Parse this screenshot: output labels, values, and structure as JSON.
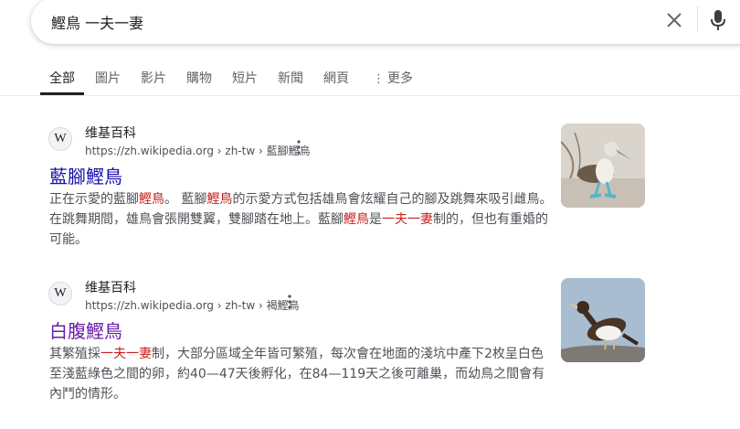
{
  "search": {
    "query": "鰹鳥 一夫一妻"
  },
  "tabs": [
    {
      "label": "全部"
    },
    {
      "label": "圖片"
    },
    {
      "label": "影片"
    },
    {
      "label": "購物"
    },
    {
      "label": "短片"
    },
    {
      "label": "新聞"
    },
    {
      "label": "網頁"
    },
    {
      "label": "更多"
    }
  ],
  "results": [
    {
      "favicon": "W",
      "site": "维基百科",
      "url": "https://zh.wikipedia.org › zh-tw › 藍腳鰹鳥",
      "title": "藍腳鰹鳥",
      "title_color": "#1a0dab",
      "s": [
        "正在示愛的藍腳",
        "鰹鳥",
        "。 藍腳",
        "鰹鳥",
        "的示愛方式包括雄鳥會炫耀自己的腳及跳舞來吸引雌鳥。在跳舞期間，雄鳥會張開雙翼，雙腳踏在地上。藍腳",
        "鰹鳥",
        "是",
        "一夫一妻",
        "制的，但也有重婚的可能。"
      ]
    },
    {
      "favicon": "W",
      "site": "维基百科",
      "url": "https://zh.wikipedia.org › zh-tw › 褐鰹鳥",
      "title": "白腹鰹鳥",
      "title_color": "#681da8",
      "s": [
        "其繁殖採",
        "一夫一妻",
        "制，大部分區域全年皆可繁殖，每次會在地面的淺坑中產下2枚呈白色至淺藍綠色之間的卵，約40—47天後孵化，在84—119天之後可離巢，而幼鳥之間會有內鬥的情形。"
      ]
    }
  ],
  "colors": {
    "highlight": "#c5221f",
    "visited_link": "#681da8",
    "link": "#1a0dab"
  },
  "icons": [
    "close-icon",
    "mic-icon",
    "more-vert-icon",
    "wikipedia-favicon"
  ]
}
